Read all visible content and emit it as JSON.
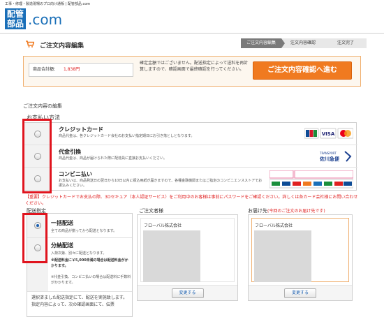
{
  "header": {
    "tagline": "工事・修理・製造現場のプロ向け通販 | 配管部品.com",
    "logo_text": "配管\n部品",
    "logo_domain": ".com",
    "brand_color": "#1a6fb8"
  },
  "title_bar": {
    "title": "ご注文内容編集",
    "steps": [
      "ご注文内容編集",
      "注文内容確認",
      "注文完了"
    ],
    "active_step": 0
  },
  "summary": {
    "total_label": "商品合計額：",
    "total_value": "1,838円",
    "note": "確定金額ではございません。配送指定によって送料を再計算しますので、確認画面で最終確認を行ってください。",
    "confirm_button": "ご注文内容確認へ進む",
    "accent_color": "#f07a20"
  },
  "edit_section": {
    "heading": "ご注文内容の編集",
    "payment_heading": "お支払い方法",
    "payment_methods": [
      {
        "name": "クレジットカード",
        "desc": "商品代金は、各クレジットカード会社のお支払い指定期日にお引き落としとなります。",
        "selected": false,
        "logos": [
          "JCB",
          "VISA",
          "MasterCard"
        ]
      },
      {
        "name": "代金引換",
        "desc": "商品代金は、商品が届けられた際に配達員に直接お支払いください。",
        "selected": false,
        "logos": [
          "佐川急便"
        ]
      },
      {
        "name": "コンビニ払い",
        "desc": "お支払いは、商品発送日の翌日から10日以内に振込用紙が届きますので、各種金融機関またはご指定のコンビニエンスストアでお振込みください。",
        "selected": false,
        "logos": [
          "コンビニ各社"
        ]
      }
    ],
    "warning": "【重要】クレジットカードでお支払の際、3Dセキュア（本人認証サービス）をご利用中のお客様は事前にパスワードをご確認ください。詳しくは各カード会社様にお問い合わせください。",
    "delivery_heading": "配送指定",
    "delivery_options": [
      {
        "name": "一括配送",
        "desc": "全ての商品が揃ってから配送となります。",
        "selected": true
      },
      {
        "name": "分納配送",
        "desc": "入荷次第、別々に配送となります。",
        "selected": false
      }
    ],
    "delivery_bold_note": "※配送料金に￥5,000未満の場合は配送料金がかかります。",
    "delivery_small_note": "※代金引換、コンビニ払いの場合は配送料に手数料がかかります。",
    "delivery_footer": "選択済ました配送指定にて、配送を実施致します。指定内容によって、次の確認画面にて、伝票"
  },
  "orderer": {
    "heading": "ご注文者様",
    "company": "フローバル株式会社",
    "button": "変更する"
  },
  "recipient": {
    "heading": "お届け先",
    "heading_note": "(今回のご注文のお届け先です)",
    "company": "フローバル株式会社",
    "button": "変更する"
  }
}
